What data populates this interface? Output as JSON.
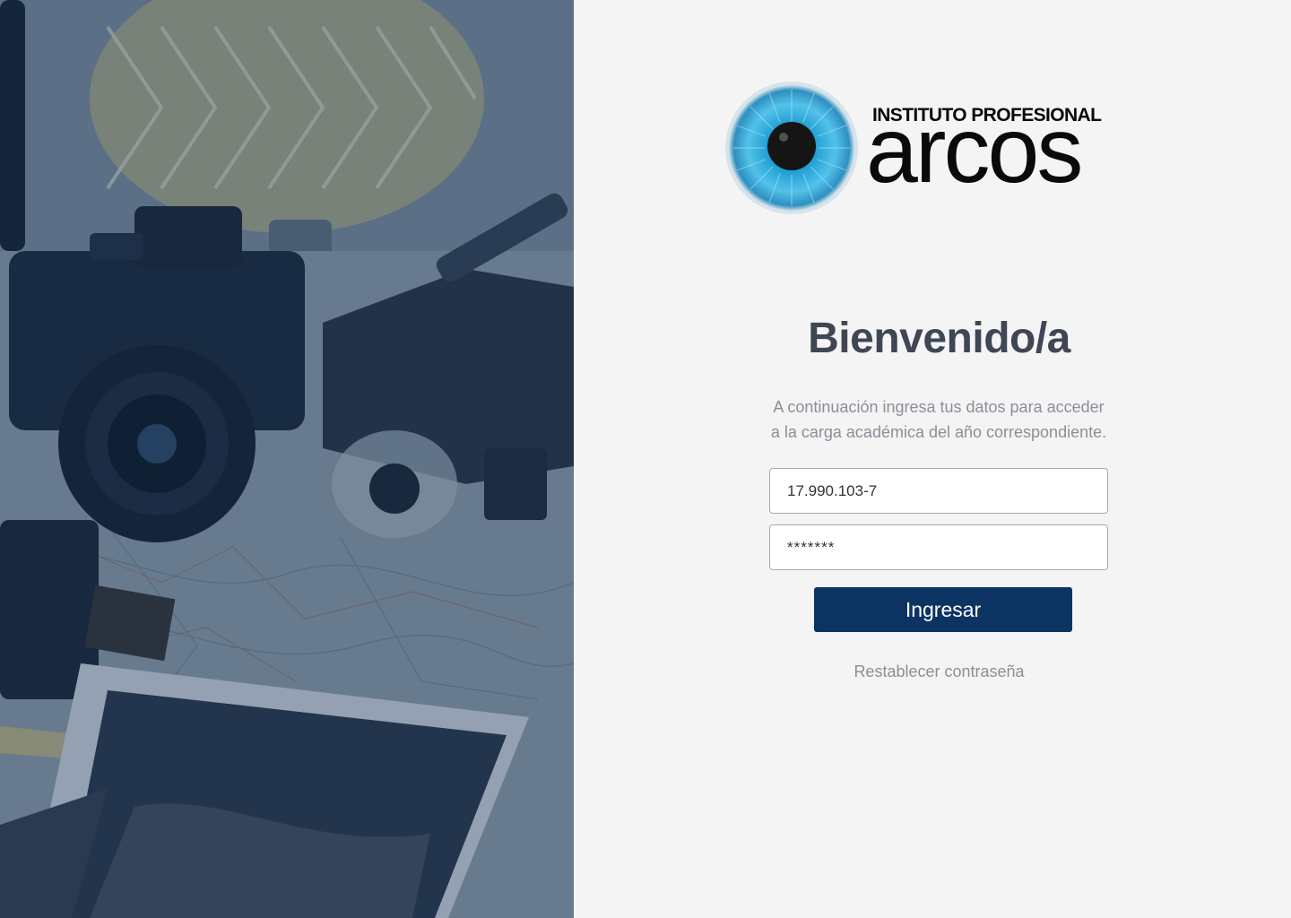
{
  "brand": {
    "subtitle": "INSTITUTO PROFESIONAL",
    "name": "arcos",
    "logo_icon": "eye-icon",
    "iris_color": "#2fa8d8"
  },
  "login": {
    "title": "Bienvenido/a",
    "intro_line1": "A continuación ingresa tus datos para acceder",
    "intro_line2": "a la carga académica del año correspondiente.",
    "username_value": "17.990.103-7",
    "password_value": "*******",
    "submit_label": "Ingresar",
    "reset_label": "Restablecer contraseña"
  },
  "colors": {
    "primary_button": "#0d3362",
    "background": "#f4f4f4",
    "overlay": "#16345c"
  },
  "photo": {
    "subject": "camera-drone-map-photo"
  }
}
